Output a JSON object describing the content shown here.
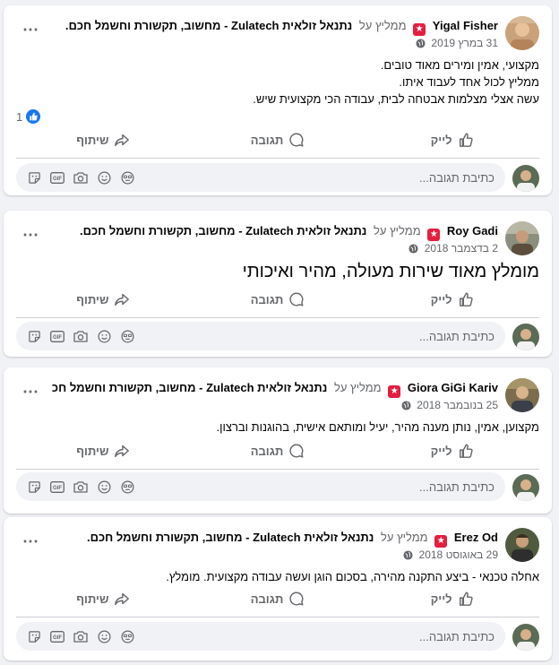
{
  "posts": [
    {
      "author": "Yigal Fisher",
      "recommends_text": "ממליץ על",
      "page_name": "נתנאל זולאית Zulatech - מחשוב, תקשורת וחשמל חכם.",
      "date": "31 במרץ 2019",
      "body": [
        "מקצועי, אמין ומירים מאוד טובים.",
        "ממליץ לכול אחד לעבוד איתו.",
        "עשה אצלי מצלמות אבטחה לבית, עבודה הכי מקצועית שיש."
      ],
      "like_count": "1"
    },
    {
      "author": "Roy Gadi",
      "recommends_text": "ממליץ על",
      "page_name": "נתנאל זולאית Zulatech - מחשוב, תקשורת וחשמל חכם.",
      "date": "2 בדצמבר 2018",
      "body": [
        "מומלץ מאוד שירות מעולה, מהיר ואיכותי"
      ]
    },
    {
      "author": "Giora GiGi Kariv",
      "recommends_text": "ממליץ על",
      "page_name": "נתנאל זולאית Zulatech - מחשוב, תקשורת וחשמל חכם.",
      "date": "25 בנובמבר 2018",
      "body": [
        "מקצוען, אמין, נותן מענה מהיר, יעיל ומותאם אישית, בהוגנות וברצון."
      ]
    },
    {
      "author": "Erez Od",
      "recommends_text": "ממליץ על",
      "page_name": "נתנאל זולאית Zulatech - מחשוב, תקשורת וחשמל חכם.",
      "date": "29 באוגוסט 2018",
      "body": [
        "אחלה טכנאי - ביצע התקנה מהירה, בסכום הוגן ועשה עבודה מקצועית. מומלץ."
      ]
    }
  ],
  "actions": {
    "like": "לייק",
    "comment": "תגובה",
    "share": "שיתוף"
  },
  "comment_placeholder": "כתיבת תגובה...",
  "icons": {
    "more": "⋯",
    "badge": "★"
  },
  "colors": {
    "like_blue": "#1877f2",
    "badge_red": "#e41e3f",
    "muted": "#65676b"
  }
}
